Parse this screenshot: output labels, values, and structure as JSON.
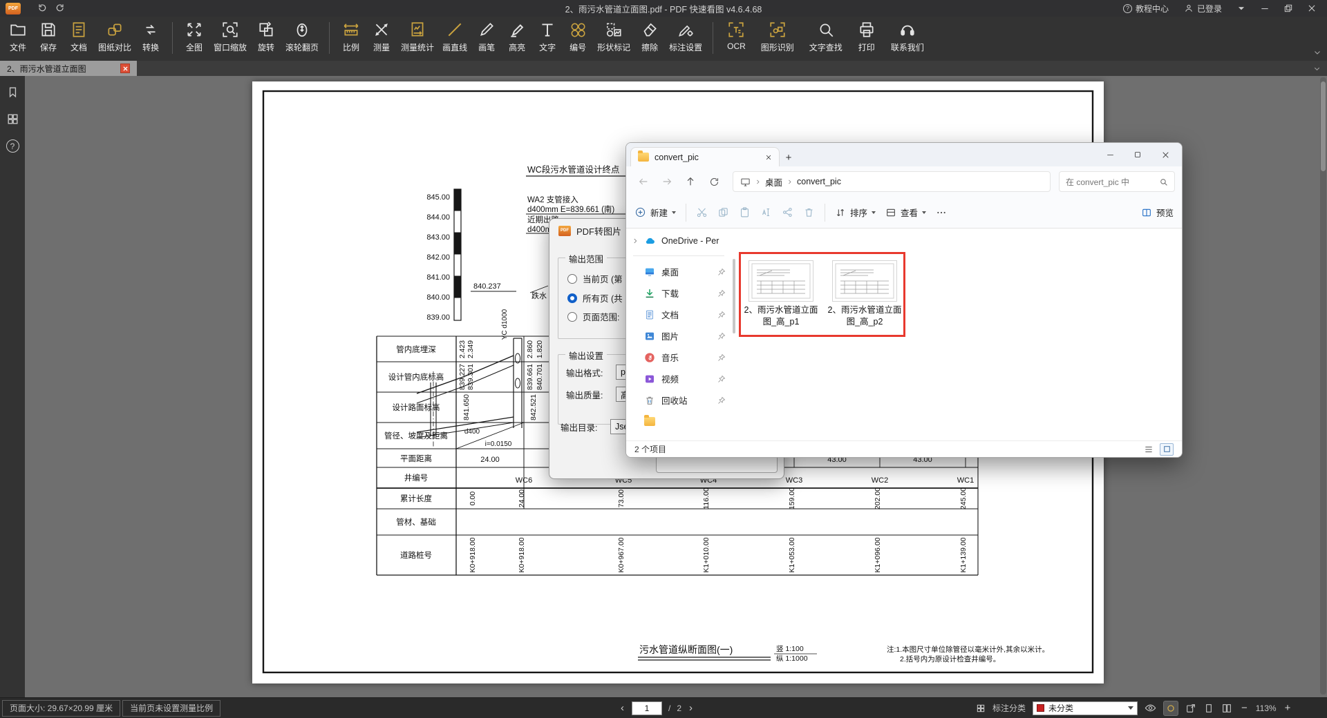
{
  "glyphs": {
    "qmark": "?",
    "plus_tab": "+",
    "dots": "…"
  },
  "titlebar": {
    "logo": "PDF",
    "title": "2、雨污水管道立面图.pdf - PDF 快速看图 v4.6.4.68",
    "help": "教程中心",
    "login": "已登录"
  },
  "toolbar": {
    "labels": [
      "文件",
      "保存",
      "文档",
      "图纸对比",
      "转换",
      "全图",
      "窗口缩放",
      "旋转",
      "滚轮翻页",
      "比例",
      "测量",
      "测量统计",
      "画直线",
      "画笔",
      "高亮",
      "文字",
      "编号",
      "形状标记",
      "擦除",
      "标注设置",
      "OCR",
      "图形识别",
      "文字查找",
      "打印",
      "联系我们"
    ]
  },
  "tab": {
    "label": "2、雨污水管道立面图"
  },
  "statusbar": {
    "page_size": "页面大小: 29.67×20.99 厘米",
    "scale_note": "当前页未设置测量比例",
    "prev": "‹",
    "next": "›",
    "page": "1",
    "slash": "/",
    "total": "2",
    "annot_class": "标注分类",
    "filter": "未分类",
    "zoom_out": "−",
    "zoom_value": "113%",
    "zoom_in": "+"
  },
  "dialog": {
    "logo": "PDF",
    "title": "PDF转图片",
    "range_group": "输出范围",
    "radio_current": "当前页 (第",
    "radio_all": "所有页 (共",
    "radio_range": "页面范围:",
    "settings_group": "输出设置",
    "format_label": "输出格式:",
    "format_value": "png",
    "quality_label": "输出质量:",
    "quality_value": "高",
    "dir_label": "输出目录:",
    "dir_value": "Jsers"
  },
  "explorer": {
    "tab": "convert_pic",
    "crumb_root": "桌面",
    "crumb_current": "convert_pic",
    "search": "在 convert_pic 中",
    "new": "新建",
    "sort": "排序",
    "view": "查看",
    "preview": "预览",
    "onedrive": "OneDrive - Per",
    "nav": [
      "桌面",
      "下载",
      "文档",
      "图片",
      "音乐",
      "视频",
      "回收站"
    ],
    "files": [
      "2、雨污水管道立面图_高_p1",
      "2、雨污水管道立面图_高_p2"
    ],
    "status": "2 个项目"
  },
  "drawing": {
    "elevations": [
      "845.00",
      "844.00",
      "843.00",
      "842.00",
      "841.00",
      "840.00",
      "839.00"
    ],
    "top_note": "WC段污水管道设计终点",
    "wa2": [
      "WA2 支管接入",
      "d400mm E=839.661 (南)",
      "近期出路",
      "d400mm"
    ],
    "spot": "840.237",
    "drop": "跌水",
    "yc": "YC d1000",
    "rows": [
      "管内底埋深",
      "设计管内底标高",
      "设计路面标高",
      "管径、坡度及距离",
      "平面距离",
      "井编号",
      "累计长度",
      "管材、基础",
      "道路桩号"
    ],
    "depths": [
      "2.423",
      "2.349",
      "2.860",
      "1.820"
    ],
    "inverts": [
      "839.227",
      "839.301",
      "839.661",
      "840.701"
    ],
    "roads": [
      "841.650",
      "842.521"
    ],
    "pipe": "d400",
    "slope": "i=0.0150",
    "plan": "24.00",
    "d1": "43.00",
    "d2": "43.00",
    "wells": [
      "WC6",
      "WC5",
      "WC4",
      "WC3",
      "WC2",
      "WC1"
    ],
    "cum": [
      "0.00",
      "24.00",
      "73.00",
      "116.00",
      "159.00",
      "202.00",
      "245.00"
    ],
    "stakes": [
      "K0+918.00",
      "K0+918.00",
      "K0+967.00",
      "K1+010.00",
      "K1+053.00",
      "K1+096.00",
      "K1+139.00"
    ],
    "title": "污水管道纵断面图(一)",
    "scale_v": "竖 1:100",
    "scale_h": "纵 1:1000",
    "notes": [
      "注:1.本图尺寸单位除管径以毫米计外,其余以米计。",
      "2.括号内为原设计检查井编号。"
    ]
  }
}
